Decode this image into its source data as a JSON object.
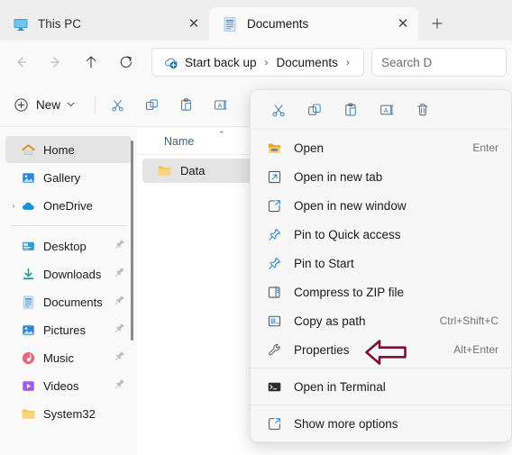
{
  "window": {
    "tabs": [
      {
        "label": "This PC",
        "icon": "monitor-icon",
        "active": false,
        "close": "✕"
      },
      {
        "label": "Documents",
        "icon": "documents-icon",
        "active": true,
        "close": "✕"
      }
    ],
    "new_tab_label": "+"
  },
  "navigation": {
    "back": "back-arrow-icon",
    "forward": "forward-arrow-icon",
    "up": "up-arrow-icon",
    "refresh": "refresh-icon",
    "breadcrumbs": [
      {
        "label": "Start back up",
        "icon": "onedrive-backup-icon"
      },
      {
        "label": "Documents",
        "icon": ""
      }
    ],
    "separator": "›",
    "search": {
      "value": "",
      "placeholder": "Search D"
    }
  },
  "commandbar": {
    "new_label": "New",
    "new_chevron": "⌄",
    "icons": [
      "cut-icon",
      "copy-icon",
      "paste-icon",
      "rename-icon"
    ]
  },
  "sidebar": {
    "items": [
      {
        "label": "Home",
        "icon": "home-icon",
        "selected": true,
        "expandable": false,
        "pinned": false
      },
      {
        "label": "Gallery",
        "icon": "gallery-icon",
        "selected": false,
        "expandable": false,
        "pinned": false
      },
      {
        "label": "OneDrive",
        "icon": "onedrive-icon",
        "selected": false,
        "expandable": true,
        "pinned": false
      },
      {
        "label": "Desktop",
        "icon": "desktop-icon",
        "selected": false,
        "expandable": false,
        "pinned": true
      },
      {
        "label": "Downloads",
        "icon": "downloads-icon",
        "selected": false,
        "expandable": false,
        "pinned": true
      },
      {
        "label": "Documents",
        "icon": "documents-icon",
        "selected": false,
        "expandable": false,
        "pinned": true
      },
      {
        "label": "Pictures",
        "icon": "pictures-icon",
        "selected": false,
        "expandable": false,
        "pinned": true
      },
      {
        "label": "Music",
        "icon": "music-icon",
        "selected": false,
        "expandable": false,
        "pinned": true
      },
      {
        "label": "Videos",
        "icon": "videos-icon",
        "selected": false,
        "expandable": false,
        "pinned": true
      },
      {
        "label": "System32",
        "icon": "folder-icon",
        "selected": false,
        "expandable": false,
        "pinned": false
      }
    ],
    "expand_chevron": "›"
  },
  "filelist": {
    "column_header": "Name",
    "sort_arrow": "⌃",
    "rows": [
      {
        "name": "Data",
        "icon": "folder-icon",
        "selected": true
      }
    ]
  },
  "context_menu": {
    "toolbar": [
      {
        "name": "cut-icon",
        "tooltip": "Cut"
      },
      {
        "name": "copy-icon",
        "tooltip": "Copy"
      },
      {
        "name": "paste-icon",
        "tooltip": "Paste"
      },
      {
        "name": "rename-icon",
        "tooltip": "Rename"
      },
      {
        "name": "delete-icon",
        "tooltip": "Delete"
      }
    ],
    "items": [
      {
        "label": "Open",
        "icon": "folder-open-icon",
        "accel": "Enter",
        "divider_after": false
      },
      {
        "label": "Open in new tab",
        "icon": "open-new-tab-icon",
        "accel": "",
        "divider_after": false
      },
      {
        "label": "Open in new window",
        "icon": "open-new-window-icon",
        "accel": "",
        "divider_after": false
      },
      {
        "label": "Pin to Quick access",
        "icon": "pin-icon",
        "accel": "",
        "divider_after": false
      },
      {
        "label": "Pin to Start",
        "icon": "pin-icon",
        "accel": "",
        "divider_after": false
      },
      {
        "label": "Compress to ZIP file",
        "icon": "zip-icon",
        "accel": "",
        "divider_after": false
      },
      {
        "label": "Copy as path",
        "icon": "copy-path-icon",
        "accel": "Ctrl+Shift+C",
        "divider_after": false
      },
      {
        "label": "Properties",
        "icon": "wrench-icon",
        "accel": "Alt+Enter",
        "divider_after": true
      },
      {
        "label": "Open in Terminal",
        "icon": "terminal-icon",
        "accel": "",
        "divider_after": true
      },
      {
        "label": "Show more options",
        "icon": "show-more-icon",
        "accel": "",
        "divider_after": false
      }
    ]
  },
  "annotation": {
    "arrow_color": "#7d1230",
    "points_to": "Properties"
  },
  "colors": {
    "accent": "#0078d4",
    "selection": "#e4e4e4",
    "folder_yellow": "#f7c968",
    "annotation": "#7d1230"
  }
}
